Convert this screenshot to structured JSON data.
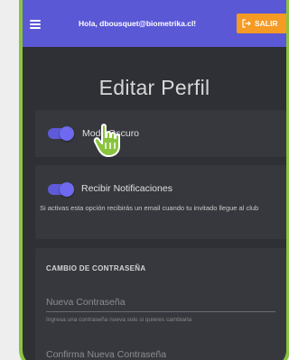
{
  "topbar": {
    "menu_icon": "hamburger-icon",
    "user_email": "Hola, dbousquet@biometrika.cl!",
    "logout_label": "SALIR",
    "logout_icon": "logout-icon",
    "color": "#5b58d6",
    "logout_color": "#f59a23"
  },
  "page": {
    "title": "Editar Perfil"
  },
  "dark_mode": {
    "label": "Modo Oscuro",
    "enabled": true
  },
  "notifications": {
    "label": "Recibir Notificaciones",
    "enabled": true,
    "hint": "Si activas esta opción recibirás un email cuando tu invitado llegue al club"
  },
  "password": {
    "heading": "CAMBIO DE CONTRASEÑA",
    "new_label": "Nueva Contraseña",
    "new_help": "Ingresa una contraseña nueva solo si quieres cambiarla",
    "confirm_label": "Confirma Nueva Contraseña"
  },
  "colors": {
    "frame": "#8ac43f",
    "background": "#2f3035",
    "card": "#37383d",
    "toggle": "#5e5ad8"
  },
  "cursor_icon": "hand-pointer-icon"
}
